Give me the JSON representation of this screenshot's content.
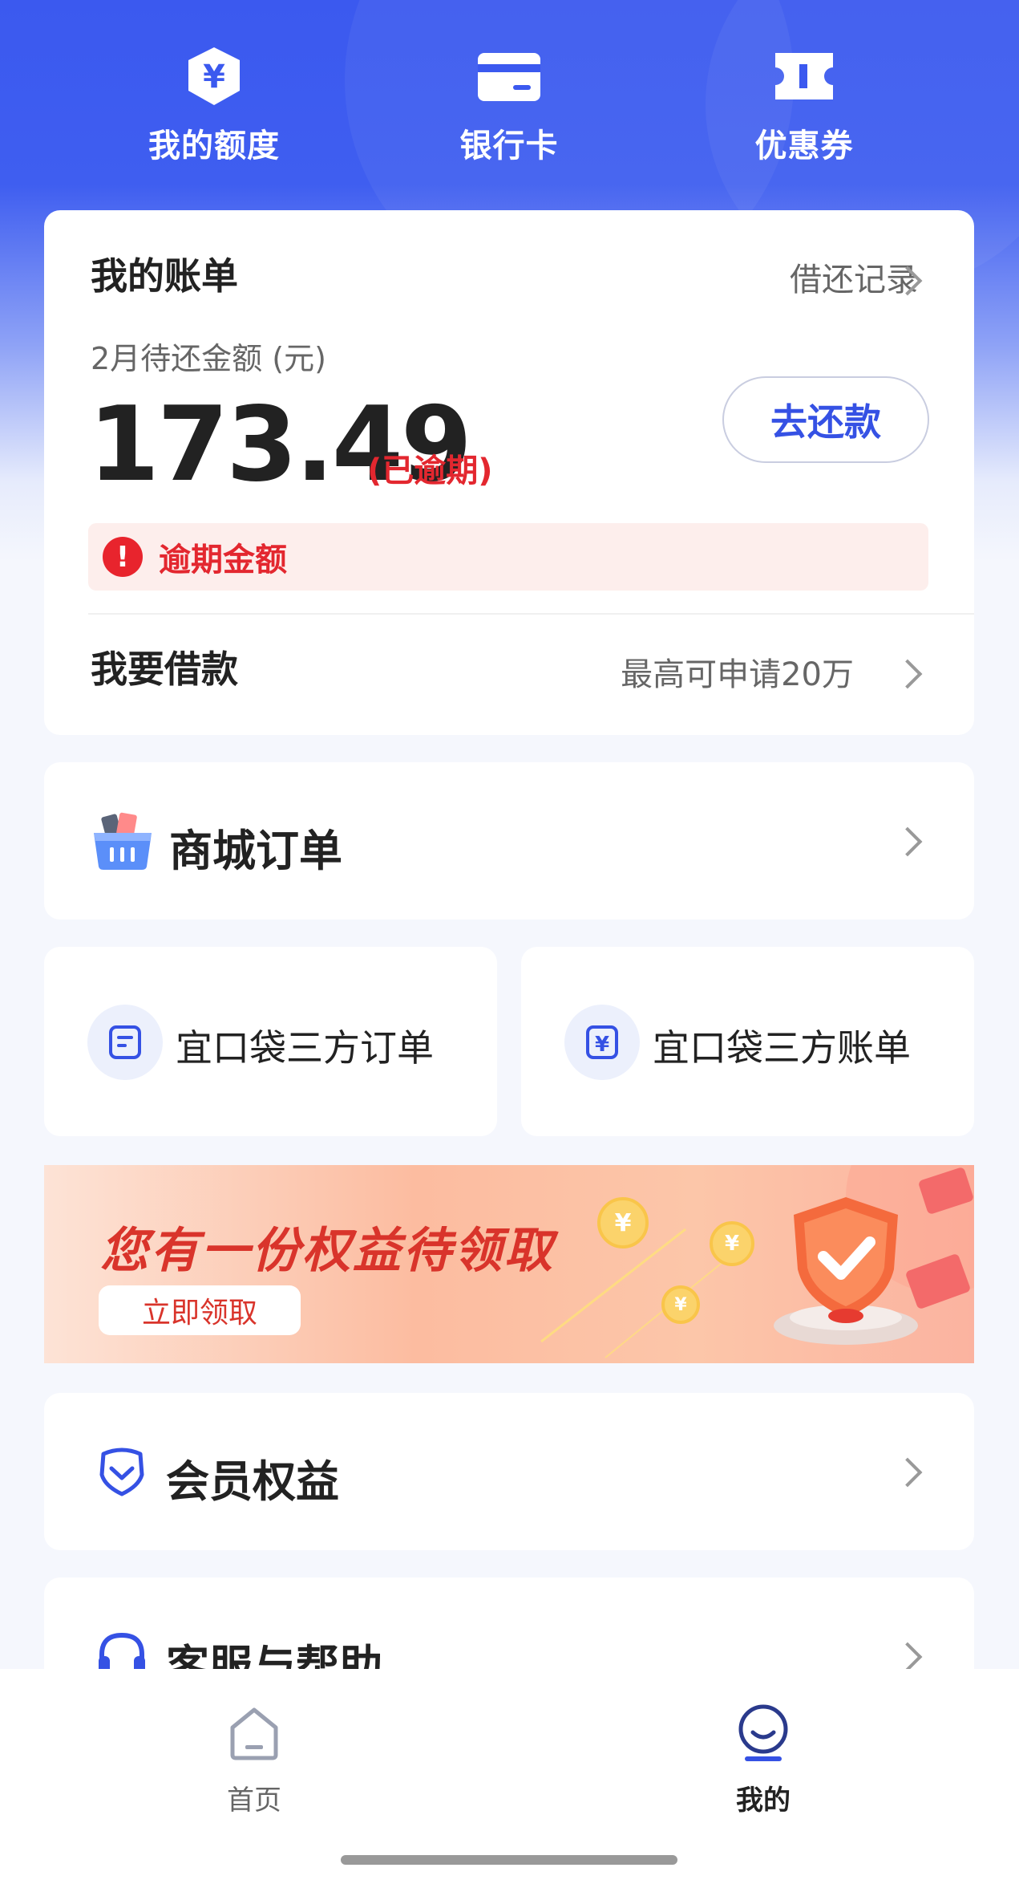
{
  "top_nav": {
    "quota_label": "我的额度",
    "bank_card_label": "银行卡",
    "coupon_label": "优惠券"
  },
  "bill": {
    "title": "我的账单",
    "history_link": "借还记录",
    "due_label": "2月待还金额 (元)",
    "amount": "173.49",
    "overdue_tag": "(已逾期)",
    "repay_button": "去还款",
    "alert_text": "逾期金额",
    "borrow_title": "我要借款",
    "borrow_hint": "最高可申请20万"
  },
  "mall_orders": {
    "label": "商城订单"
  },
  "third_party": {
    "orders_label": "宜口袋三方订单",
    "bills_label": "宜口袋三方账单"
  },
  "banner": {
    "title": "您有一份权益待领取",
    "button": "立即领取"
  },
  "vip": {
    "label": "会员权益"
  },
  "help": {
    "label": "客服与帮助"
  },
  "tab_bar": {
    "home_label": "首页",
    "mine_label": "我的",
    "active": "mine"
  },
  "colors": {
    "brand_blue": "#3b59ef",
    "alert_red": "#e3272f",
    "alert_bg": "#fdeeec"
  },
  "icons": [
    "yuan-shield-icon",
    "bank-card-icon",
    "ticket-icon",
    "chevron-right-icon",
    "alert-icon",
    "basket-icon",
    "order-doc-icon",
    "yuan-doc-icon",
    "vip-shield-icon",
    "headset-icon",
    "home-icon",
    "profile-icon"
  ]
}
